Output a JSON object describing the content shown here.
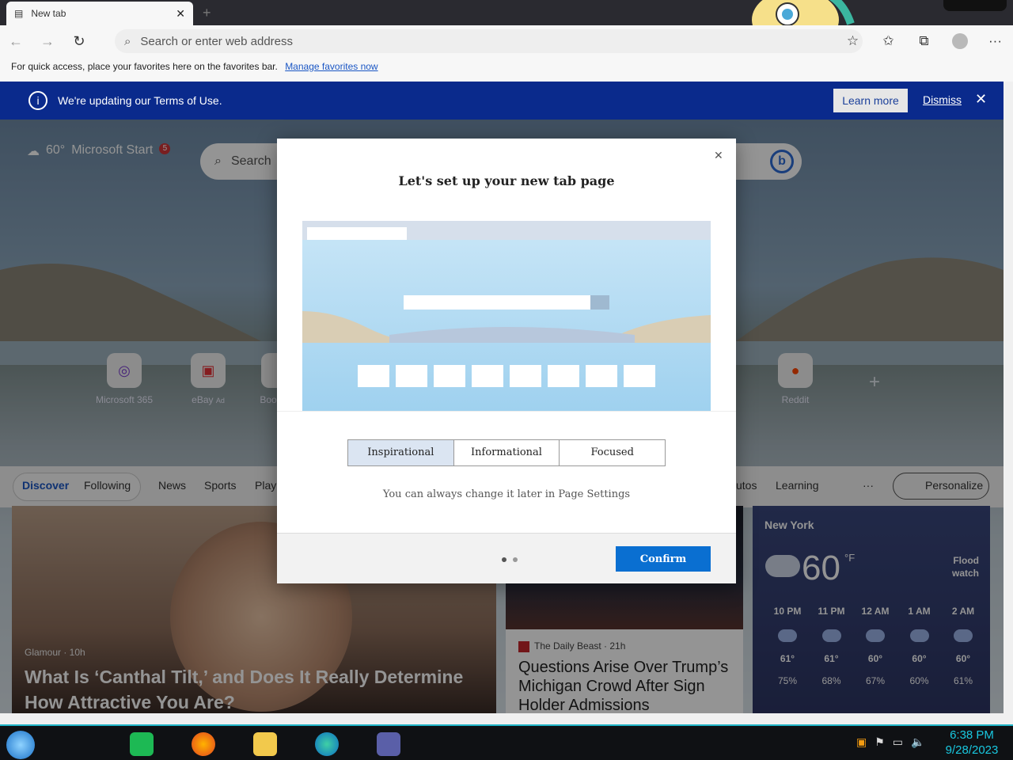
{
  "tab": {
    "title": "New tab"
  },
  "address": {
    "placeholder": "Search or enter web address"
  },
  "favorites_bar": {
    "message": "For quick access, place your favorites here on the favorites bar.",
    "link": "Manage favorites now"
  },
  "banner": {
    "text": "We're updating our Terms of Use.",
    "learn_more": "Learn more",
    "dismiss": "Dismiss"
  },
  "ntp": {
    "weather_temp": "60°",
    "brand": "Microsoft Start",
    "notification_count": "5",
    "search_placeholder": "Search",
    "quick_links": [
      {
        "label": "Microsoft 365"
      },
      {
        "label": "eBay",
        "ad": "Ad"
      },
      {
        "label": "Boo"
      },
      {
        "label": "Reddit"
      }
    ]
  },
  "feed_nav": {
    "discover": "Discover",
    "following": "Following",
    "items": [
      "News",
      "Sports",
      "Play",
      "utos",
      "Learning"
    ],
    "more": "···",
    "personalize": "Personalize"
  },
  "main_card": {
    "source": "Glamour · 10h",
    "headline": "What Is ‘Canthal Tilt,’ and Does It Really Determine How Attractive You Are?"
  },
  "mid_card": {
    "source": "The Daily Beast · 21h",
    "headline": "Questions Arise Over Trump’s Michigan Crowd After Sign Holder Admissions"
  },
  "weather_card": {
    "city": "New York",
    "temp": "60",
    "unit": "°F",
    "alert": "Flood watch",
    "hours": [
      {
        "time": "10 PM",
        "temp": "61°",
        "precip": "75%"
      },
      {
        "time": "11 PM",
        "temp": "61°",
        "precip": "68%"
      },
      {
        "time": "12 AM",
        "temp": "60°",
        "precip": "67%"
      },
      {
        "time": "1 AM",
        "temp": "60°",
        "precip": "60%"
      },
      {
        "time": "2 AM",
        "temp": "60°",
        "precip": "61%"
      }
    ]
  },
  "dialog": {
    "title": "Let's set up your new tab page",
    "options": [
      "Inspirational",
      "Informational",
      "Focused"
    ],
    "selected": "Inspirational",
    "hint": "You can always change it later in Page Settings",
    "confirm": "Confirm",
    "page_count": 2,
    "current_page": 1
  },
  "taskbar": {
    "time": "6:38 PM",
    "date": "9/28/2023"
  },
  "colors": {
    "banner": "#0a2a8c",
    "confirm": "#0a6fd1",
    "accent": "#21b5c8"
  }
}
